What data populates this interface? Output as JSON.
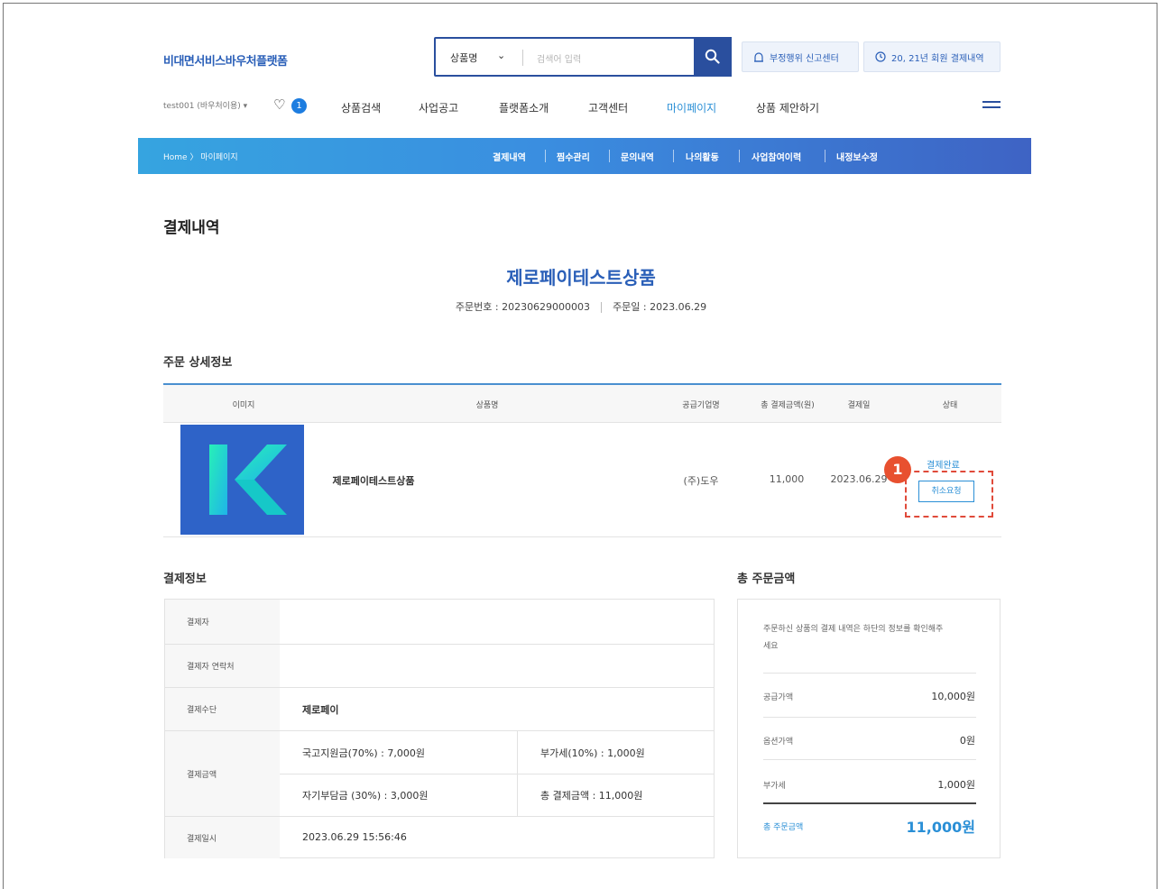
{
  "header": {
    "logo": "비대면서비스바우처플랫폼",
    "search": {
      "category": "상품명",
      "placeholder": "검색어 입력"
    },
    "report_center": "부정행위 신고센터",
    "history_button": "20, 21년 회원 결제내역",
    "user": "test001 (바우처이용) ▾",
    "heart_count": "1",
    "nav": [
      "상품검색",
      "사업공고",
      "플랫폼소개",
      "고객센터",
      "마이페이지",
      "상품 제안하기"
    ]
  },
  "band": {
    "breadcrumb": "Home  〉 마이페이지",
    "subnav": [
      "결제내역",
      "찜수관리",
      "문의내역",
      "나의활동",
      "사업참여이력",
      "내정보수정"
    ]
  },
  "page": {
    "title": "결제내역",
    "product_title": "제로페이테스트상품",
    "order_no": "주문번호 : 20230629000003",
    "order_date": "주문일 : 2023.06.29"
  },
  "order_detail": {
    "section": "주문 상세정보",
    "columns": [
      "이미지",
      "상품명",
      "공급기업명",
      "총 결제금액(원)",
      "결제일",
      "상태"
    ],
    "row": {
      "thumb_letter": "K",
      "name": "제로페이테스트상품",
      "supplier": "(주)도우",
      "amount": "11,000",
      "date": "2023.06.29",
      "status": "결제완료",
      "cancel": "취소요청"
    },
    "callout": "1"
  },
  "payment_info": {
    "section": "결제정보",
    "labels": [
      "결제자",
      "결제자 연락처",
      "결제수단",
      "결제금액",
      "결제일시"
    ],
    "method": "제로페이",
    "gov_support": "국고지원금(70%) : 7,000원",
    "vat": "부가세(10%) : 1,000원",
    "self_pay": "자기부담금 (30%) : 3,000원",
    "total_pay": "총 결제금액 : 11,000원",
    "paid_at": "2023.06.29 15:56:46"
  },
  "summary": {
    "section": "총 주문금액",
    "note": "주문하신 상품의 결제 내역은 하단의 정보를 확인해주세요",
    "supply_label": "공급가액",
    "supply_value": "10,000원",
    "option_label": "옵션가액",
    "option_value": "0원",
    "vat_label": "부가세",
    "vat_value": "1,000원",
    "total_label": "총 주문금액",
    "total_value": "11,000원"
  },
  "colors": {
    "brand": "#2a5fb8",
    "accent": "#2a8fd6",
    "callout": "#e8502f",
    "logo_k": "#2de0c0"
  },
  "icons": [
    "search-icon",
    "chevron-down-icon",
    "siren-icon",
    "clock-icon",
    "heart-icon",
    "menu-icon"
  ]
}
